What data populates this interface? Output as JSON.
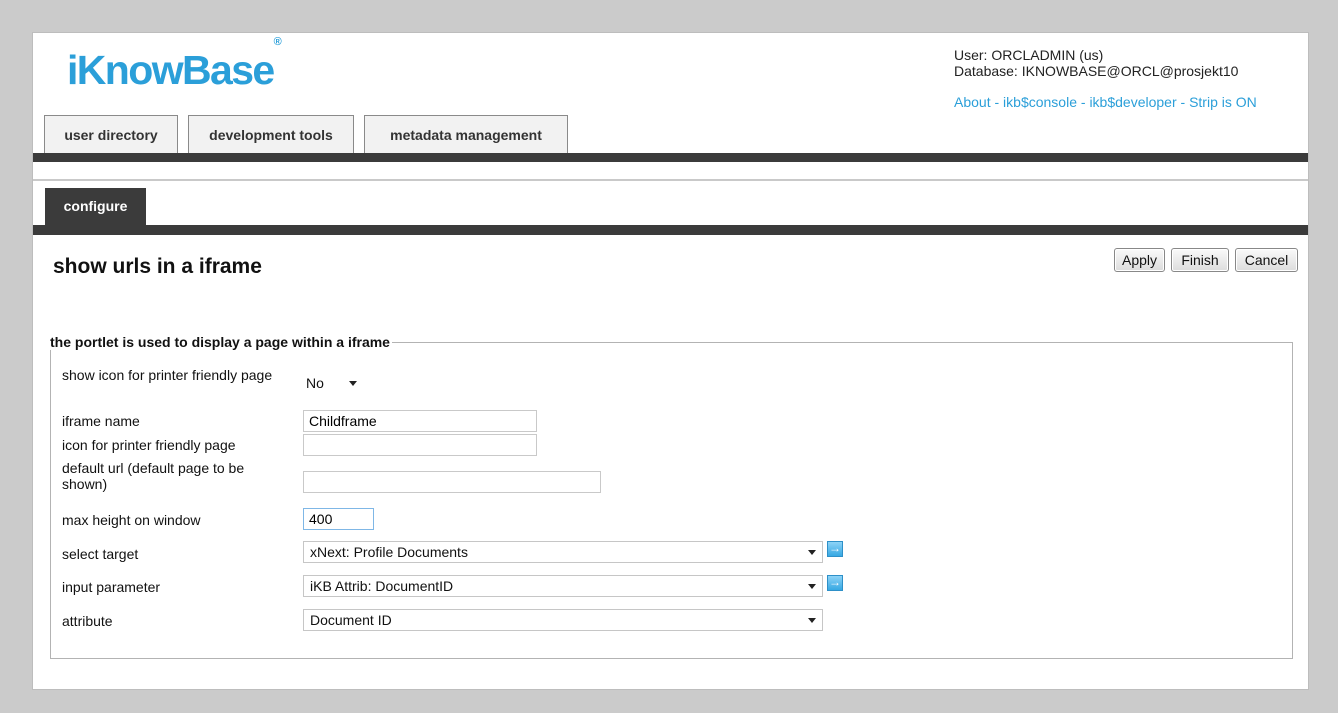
{
  "header": {
    "logo_text": "iKnowBase",
    "logo_mark": "®",
    "user_line": "User: ORCLADMIN (us)",
    "database_line": "Database: IKNOWBASE@ORCL@prosjekt10",
    "links": [
      "About",
      "ikb$console",
      "ikb$developer",
      "Strip is ON"
    ],
    "link_separator": "-"
  },
  "main_tabs": [
    "user directory",
    "development tools",
    "metadata management"
  ],
  "sub_tabs": [
    "configure"
  ],
  "page": {
    "title": "show urls in a iframe"
  },
  "actions": {
    "apply": "Apply",
    "finish": "Finish",
    "cancel": "Cancel"
  },
  "form": {
    "legend": "the portlet is used to display a page within a iframe",
    "fields": {
      "printer_icon_show": {
        "label": "show icon for printer friendly page",
        "value": "No"
      },
      "iframe_name": {
        "label": "iframe name",
        "value": "Childframe"
      },
      "printer_icon": {
        "label": "icon for printer friendly page",
        "value": ""
      },
      "default_url": {
        "label": "default url (default page to be shown)",
        "value": ""
      },
      "max_height": {
        "label": "max height on window",
        "value": "400"
      },
      "select_target": {
        "label": "select target",
        "value": "xNext: Profile Documents"
      },
      "input_parameter": {
        "label": "input parameter",
        "value": "iKB Attrib: DocumentID"
      },
      "attribute": {
        "label": "attribute",
        "value": "Document ID"
      }
    }
  },
  "icons": {
    "go": "arrow-right-icon",
    "caret": "chevron-down-icon"
  },
  "colors": {
    "accent": "#2b9fd9",
    "bar": "#3b3b3b",
    "background": "#cbcbcb"
  }
}
